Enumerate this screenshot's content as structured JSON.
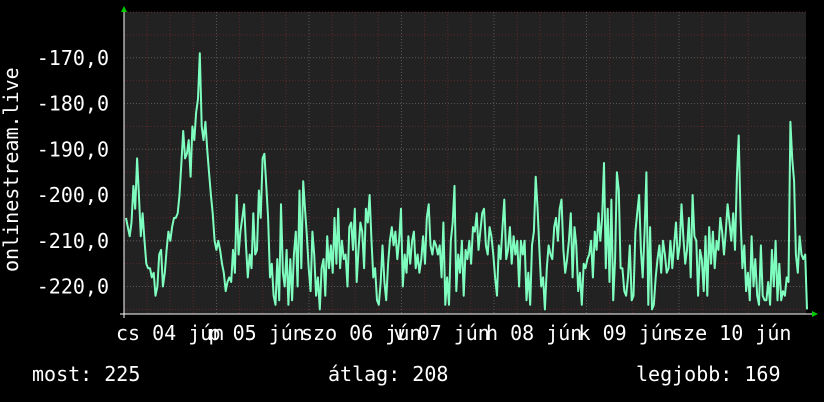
{
  "chart_data": {
    "type": "line",
    "ylabel": "onlinestream.live",
    "ylim": [
      -226,
      -160
    ],
    "yticks": [
      -170,
      -180,
      -190,
      -200,
      -210,
      -220
    ],
    "ytick_labels": [
      "-170,0",
      "-180,0",
      "-190,0",
      "-200,0",
      "-210,0",
      "-220,0"
    ],
    "xtick_labels": [
      "cs 04 jún",
      "p 05 jún",
      "szo 06 jún",
      "v 07 jún",
      "h 08 jún",
      "k 09 jún",
      "sze 10 jún"
    ],
    "grid": true,
    "colors": {
      "background": "#000000",
      "plot_background": "#222222",
      "grid": "#4a4a4a",
      "grid_minor": "#6a2a2a",
      "line": "#7fffbf",
      "axis_arrow": "#00cc00"
    },
    "series": [
      {
        "values": [
          -205,
          -207,
          -209,
          -206,
          -198,
          -203,
          -192,
          -200,
          -209,
          -204,
          -210,
          -215,
          -216,
          -216,
          -218,
          -217,
          -222,
          -220,
          -213,
          -212,
          -220,
          -217,
          -212,
          -208,
          -210,
          -207,
          -205,
          -205,
          -204,
          -200,
          -193,
          -186,
          -192,
          -191,
          -188,
          -196,
          -185,
          -188,
          -182,
          -179,
          -169,
          -185,
          -188,
          -184,
          -190,
          -195,
          -200,
          -204,
          -210,
          -212,
          -210,
          -212,
          -215,
          -217,
          -221,
          -219,
          -218,
          -219,
          -212,
          -217,
          -200,
          -213,
          -208,
          -205,
          -202,
          -211,
          -218,
          -213,
          -216,
          -204,
          -213,
          -212,
          -199,
          -205,
          -192,
          -191,
          -198,
          -205,
          -218,
          -215,
          -222,
          -224,
          -214,
          -223,
          -202,
          -217,
          -220,
          -212,
          -224,
          -214,
          -223,
          -213,
          -208,
          -220,
          -199,
          -216,
          -197,
          -203,
          -209,
          -216,
          -221,
          -208,
          -213,
          -222,
          -218,
          -225,
          -216,
          -214,
          -222,
          -209,
          -216,
          -211,
          -217,
          -205,
          -215,
          -203,
          -216,
          -210,
          -214,
          -213,
          -220,
          -207,
          -206,
          -212,
          -203,
          -219,
          -212,
          -206,
          -208,
          -216,
          -203,
          -206,
          -200,
          -210,
          -218,
          -216,
          -223,
          -224,
          -219,
          -211,
          -219,
          -223,
          -215,
          -210,
          -207,
          -211,
          -208,
          -214,
          -210,
          -203,
          -220,
          -213,
          -217,
          -209,
          -215,
          -210,
          -208,
          -216,
          -213,
          -217,
          -214,
          -209,
          -215,
          -205,
          -202,
          -211,
          -213,
          -210,
          -211,
          -213,
          -211,
          -218,
          -206,
          -224,
          -218,
          -224,
          -210,
          -206,
          -198,
          -221,
          -213,
          -217,
          -210,
          -222,
          -212,
          -214,
          -210,
          -215,
          -207,
          -208,
          -204,
          -212,
          -208,
          -204,
          -203,
          -211,
          -213,
          -207,
          -209,
          -213,
          -218,
          -222,
          -211,
          -214,
          -207,
          -201,
          -214,
          -212,
          -207,
          -215,
          -209,
          -213,
          -210,
          -220,
          -210,
          -213,
          -210,
          -223,
          -217,
          -224,
          -211,
          -208,
          -196,
          -203,
          -212,
          -220,
          -218,
          -225,
          -216,
          -211,
          -213,
          -214,
          -207,
          -205,
          -210,
          -203,
          -201,
          -212,
          -217,
          -214,
          -210,
          -204,
          -218,
          -207,
          -211,
          -221,
          -217,
          -224,
          -215,
          -216,
          -214,
          -213,
          -210,
          -218,
          -208,
          -212,
          -204,
          -210,
          -205,
          -193,
          -216,
          -203,
          -219,
          -201,
          -223,
          -214,
          -195,
          -199,
          -216,
          -216,
          -221,
          -222,
          -218,
          -211,
          -223,
          -222,
          -208,
          -204,
          -200,
          -212,
          -218,
          -208,
          -195,
          -224,
          -207,
          -225,
          -224,
          -218,
          -214,
          -211,
          -217,
          -210,
          -213,
          -217,
          -216,
          -210,
          -216,
          -211,
          -206,
          -214,
          -211,
          -202,
          -209,
          -215,
          -212,
          -205,
          -218,
          -200,
          -209,
          -210,
          -222,
          -212,
          -214,
          -221,
          -209,
          -222,
          -207,
          -215,
          -208,
          -216,
          -210,
          -212,
          -205,
          -208,
          -213,
          -208,
          -202,
          -206,
          -210,
          -204,
          -212,
          -196,
          -187,
          -205,
          -216,
          -211,
          -221,
          -217,
          -223,
          -209,
          -220,
          -214,
          -222,
          -224,
          -211,
          -222,
          -223,
          -223,
          -219,
          -224,
          -212,
          -220,
          -210,
          -223,
          -215,
          -223,
          -221,
          -222,
          -218,
          -219,
          -184,
          -192,
          -197,
          -213,
          -217,
          -209,
          -213,
          -214,
          -213,
          -225
        ]
      }
    ]
  },
  "stats": {
    "now_label": "most:",
    "now_value": "225",
    "avg_label": "átlag:",
    "avg_value": "208",
    "best_label": "legjobb:",
    "best_value": "169"
  }
}
